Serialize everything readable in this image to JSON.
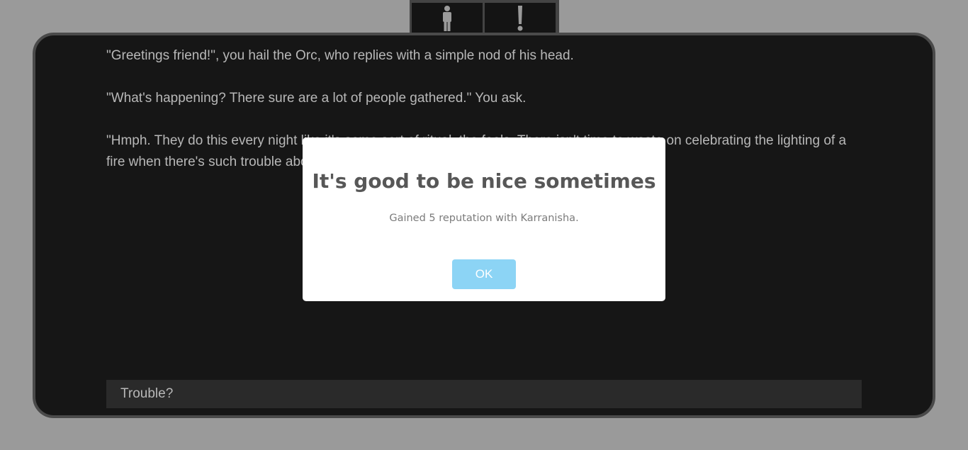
{
  "tabs": [
    {
      "icon": "person-icon"
    },
    {
      "icon": "exclamation-icon"
    }
  ],
  "story": {
    "paragraphs": [
      "\"Greetings friend!\", you hail the Orc, who replies with a simple nod of his head.",
      "\"What's happening? There sure are a lot of people gathered.\" You ask.",
      "\"Hmph. They do this every night like it's some sort of ritual, the fools. There isn't time to waste on celebrating the lighting of a fire when there's such trouble about.\""
    ]
  },
  "choices": [
    {
      "label": "Trouble?"
    }
  ],
  "modal": {
    "title": "It's good to be nice sometimes",
    "text": "Gained 5 reputation with Karranisha.",
    "ok_label": "OK"
  },
  "colors": {
    "background": "#9a9a9a",
    "panel": "#161616",
    "panel_border": "#4a4a4a",
    "text": "#b8b8b8",
    "ok_button": "#8cd4f5"
  }
}
